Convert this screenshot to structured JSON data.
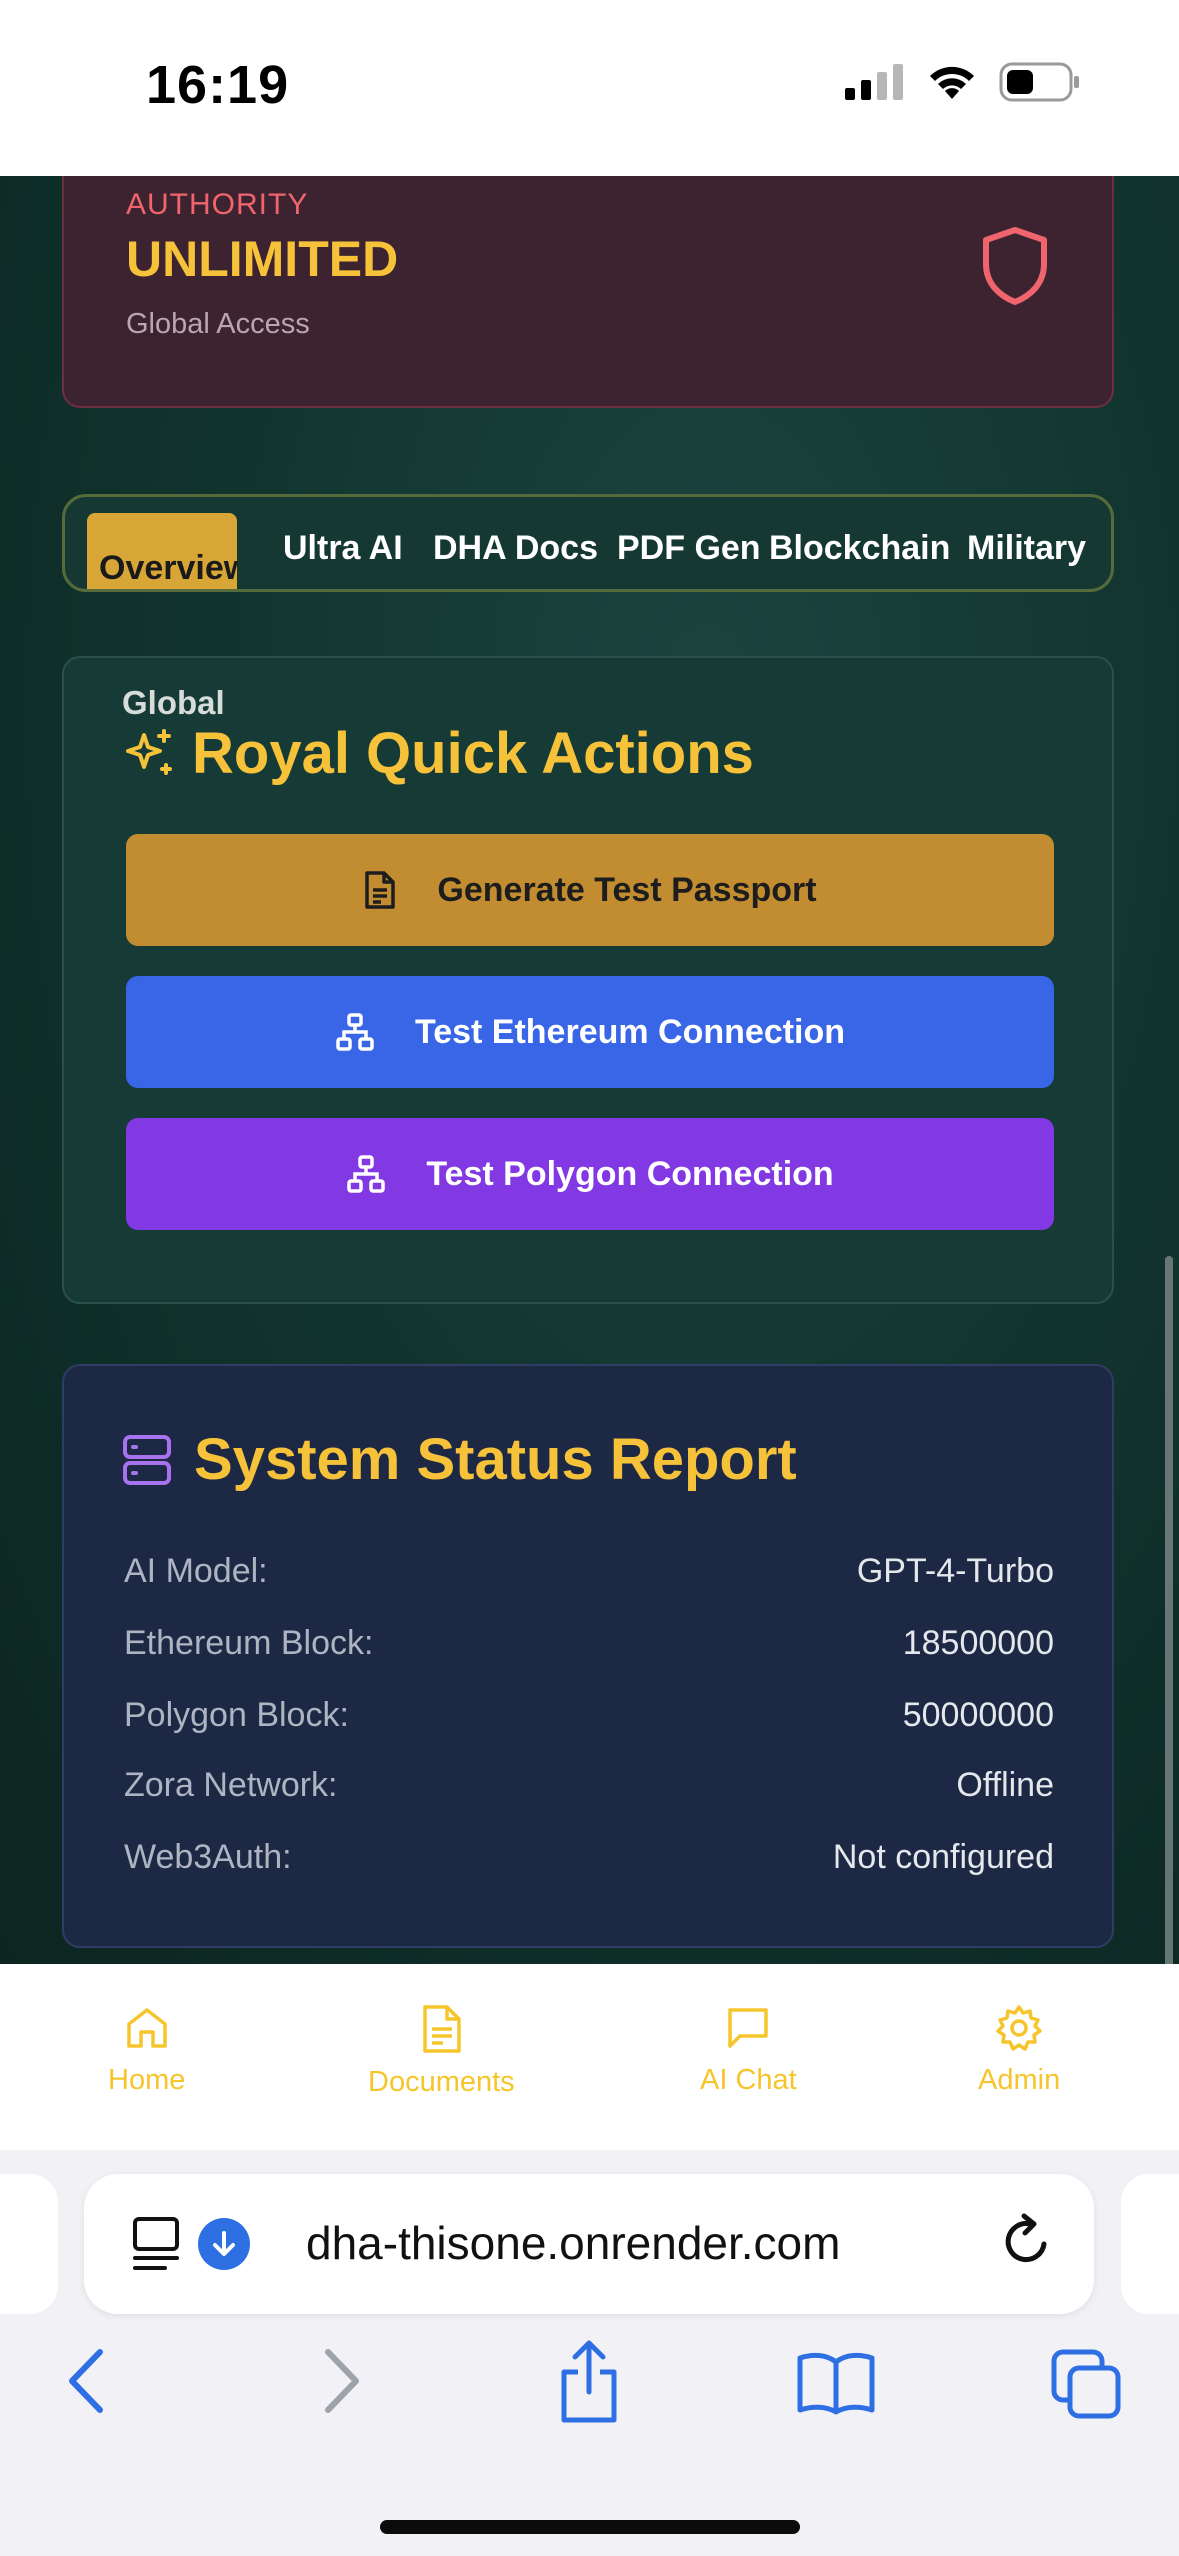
{
  "status_bar": {
    "time": "16:19"
  },
  "authority_card": {
    "label": "AUTHORITY",
    "value": "UNLIMITED",
    "subtitle": "Global Access",
    "icon": "shield-icon"
  },
  "tabs": [
    {
      "label": "Overview",
      "active": true
    },
    {
      "label": "Ultra AI"
    },
    {
      "label": "DHA Docs"
    },
    {
      "label": "PDF Gen"
    },
    {
      "label": "Blockchain"
    },
    {
      "label": "Military"
    }
  ],
  "quick_actions": {
    "overline": "Global",
    "title": "Royal Quick Actions",
    "icon": "sparkles-icon",
    "buttons": [
      {
        "label": "Generate Test Passport",
        "icon": "document-icon",
        "color": "#c28d30"
      },
      {
        "label": "Test Ethereum Connection",
        "icon": "network-icon",
        "color": "#3866e6"
      },
      {
        "label": "Test Polygon Connection",
        "icon": "network-icon",
        "color": "#8238e2"
      }
    ]
  },
  "system_status": {
    "title": "System Status Report",
    "icon": "server-icon",
    "rows": [
      {
        "label": "AI Model:",
        "value": "GPT-4-Turbo"
      },
      {
        "label": "Ethereum Block:",
        "value": "18500000"
      },
      {
        "label": "Polygon Block:",
        "value": "50000000"
      },
      {
        "label": "Zora Network:",
        "value": "Offline"
      },
      {
        "label": "Web3Auth:",
        "value": "Not configured"
      }
    ]
  },
  "bottom_nav": [
    {
      "label": "Home",
      "icon": "home-icon"
    },
    {
      "label": "Documents",
      "icon": "document-icon"
    },
    {
      "label": "AI Chat",
      "icon": "chat-icon"
    },
    {
      "label": "Admin",
      "icon": "gear-icon"
    }
  ],
  "browser": {
    "url": "dha-thisone.onrender.com"
  },
  "colors": {
    "accent": "#f5c23a",
    "nav": "#f5c52b"
  }
}
